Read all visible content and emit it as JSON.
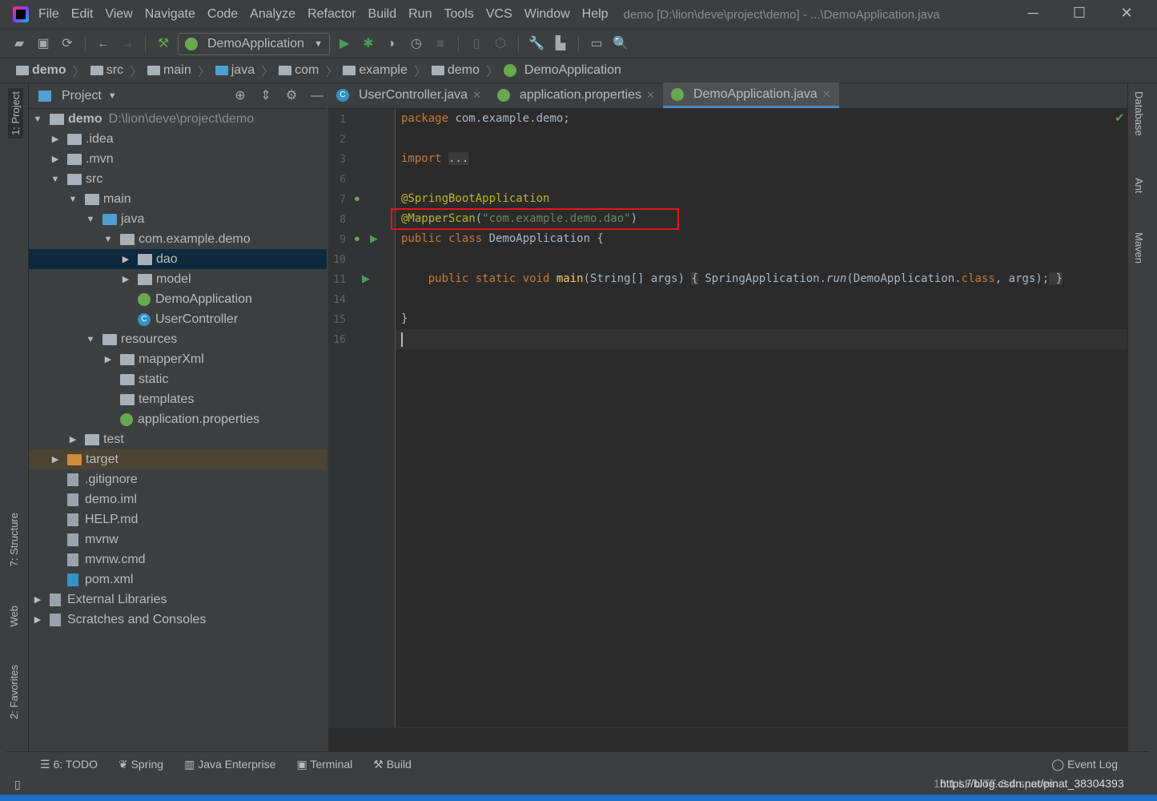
{
  "window": {
    "title": "demo [D:\\lion\\deve\\project\\demo] - ...\\DemoApplication.java",
    "controls": [
      "─",
      "☐",
      "✕"
    ]
  },
  "menu": [
    "File",
    "Edit",
    "View",
    "Navigate",
    "Code",
    "Analyze",
    "Refactor",
    "Build",
    "Run",
    "Tools",
    "VCS",
    "Window",
    "Help"
  ],
  "toolbar": {
    "run_config": "DemoApplication"
  },
  "breadcrumb": [
    "demo",
    "src",
    "main",
    "java",
    "com",
    "example",
    "demo",
    "DemoApplication"
  ],
  "project": {
    "header": "Project",
    "tree": [
      {
        "label": "demo",
        "path": "D:\\lion\\deve\\project\\demo",
        "depth": 0,
        "arrow": "▼",
        "icon": "folder",
        "bold": true
      },
      {
        "label": ".idea",
        "depth": 1,
        "arrow": "▶",
        "icon": "folder"
      },
      {
        "label": ".mvn",
        "depth": 1,
        "arrow": "▶",
        "icon": "folder"
      },
      {
        "label": "src",
        "depth": 1,
        "arrow": "▼",
        "icon": "folder"
      },
      {
        "label": "main",
        "depth": 2,
        "arrow": "▼",
        "icon": "folder"
      },
      {
        "label": "java",
        "depth": 3,
        "arrow": "▼",
        "icon": "folder-blue"
      },
      {
        "label": "com.example.demo",
        "depth": 4,
        "arrow": "▼",
        "icon": "package"
      },
      {
        "label": "dao",
        "depth": 5,
        "arrow": "▶",
        "icon": "package",
        "selected": true
      },
      {
        "label": "model",
        "depth": 5,
        "arrow": "▶",
        "icon": "package"
      },
      {
        "label": "DemoApplication",
        "depth": 5,
        "arrow": "",
        "icon": "spring-class"
      },
      {
        "label": "UserController",
        "depth": 5,
        "arrow": "",
        "icon": "class"
      },
      {
        "label": "resources",
        "depth": 3,
        "arrow": "▼",
        "icon": "folder"
      },
      {
        "label": "mapperXml",
        "depth": 4,
        "arrow": "▶",
        "icon": "folder"
      },
      {
        "label": "static",
        "depth": 4,
        "arrow": "",
        "icon": "folder"
      },
      {
        "label": "templates",
        "depth": 4,
        "arrow": "",
        "icon": "folder"
      },
      {
        "label": "application.properties",
        "depth": 4,
        "arrow": "",
        "icon": "spring"
      },
      {
        "label": "test",
        "depth": 2,
        "arrow": "▶",
        "icon": "folder"
      },
      {
        "label": "target",
        "depth": 1,
        "arrow": "▶",
        "icon": "folder-orange",
        "excluded": true
      },
      {
        "label": ".gitignore",
        "depth": 1,
        "arrow": "",
        "icon": "file"
      },
      {
        "label": "demo.iml",
        "depth": 1,
        "arrow": "",
        "icon": "file"
      },
      {
        "label": "HELP.md",
        "depth": 1,
        "arrow": "",
        "icon": "file"
      },
      {
        "label": "mvnw",
        "depth": 1,
        "arrow": "",
        "icon": "file"
      },
      {
        "label": "mvnw.cmd",
        "depth": 1,
        "arrow": "",
        "icon": "file"
      },
      {
        "label": "pom.xml",
        "depth": 1,
        "arrow": "",
        "icon": "maven"
      },
      {
        "label": "External Libraries",
        "depth": 0,
        "arrow": "▶",
        "icon": "library"
      },
      {
        "label": "Scratches and Consoles",
        "depth": 0,
        "arrow": "▶",
        "icon": "scratch"
      }
    ]
  },
  "tabs": [
    {
      "label": "UserController.java",
      "active": false
    },
    {
      "label": "application.properties",
      "active": false
    },
    {
      "label": "DemoApplication.java",
      "active": true
    }
  ],
  "editor": {
    "lines": [
      {
        "n": "1",
        "html": "<span class='kw'>package</span> com.example.demo;"
      },
      {
        "n": "2",
        "html": ""
      },
      {
        "n": "3",
        "html": "<span class='kw'>import</span> <span class='fold'>...</span>"
      },
      {
        "n": "6",
        "html": ""
      },
      {
        "n": "7",
        "html": "<span class='an'>@SpringBootApplication</span>"
      },
      {
        "n": "8",
        "html": "<span class='an'>@MapperScan</span>(<span class='st'>\"com.example.demo.dao\"</span>)"
      },
      {
        "n": "9",
        "html": "<span class='kw'>public class</span> DemoApplication {"
      },
      {
        "n": "10",
        "html": ""
      },
      {
        "n": "11",
        "html": "    <span class='kw'>public static void</span> <span class='fn'>main</span>(String[] args) <span class='fold'>{</span> SpringApplication.<span class='it'>run</span>(DemoApplication.<span class='kw'>class</span>, args);<span class='fold'> }</span>"
      },
      {
        "n": "14",
        "html": ""
      },
      {
        "n": "15",
        "html": "}"
      },
      {
        "n": "16",
        "html": ""
      }
    ]
  },
  "left_tools": [
    "1: Project",
    "7: Structure",
    "Web",
    "2: Favorites"
  ],
  "right_tools": [
    "Database",
    "Ant",
    "Maven"
  ],
  "bottom_tools": [
    "6: TODO",
    "Spring",
    "Java Enterprise",
    "Terminal",
    "Build"
  ],
  "event_log": "Event Log",
  "status": "16:1   LF   UTF-8   4 spaces",
  "watermark": "https://blog.csdn.net/pinat_38304393"
}
